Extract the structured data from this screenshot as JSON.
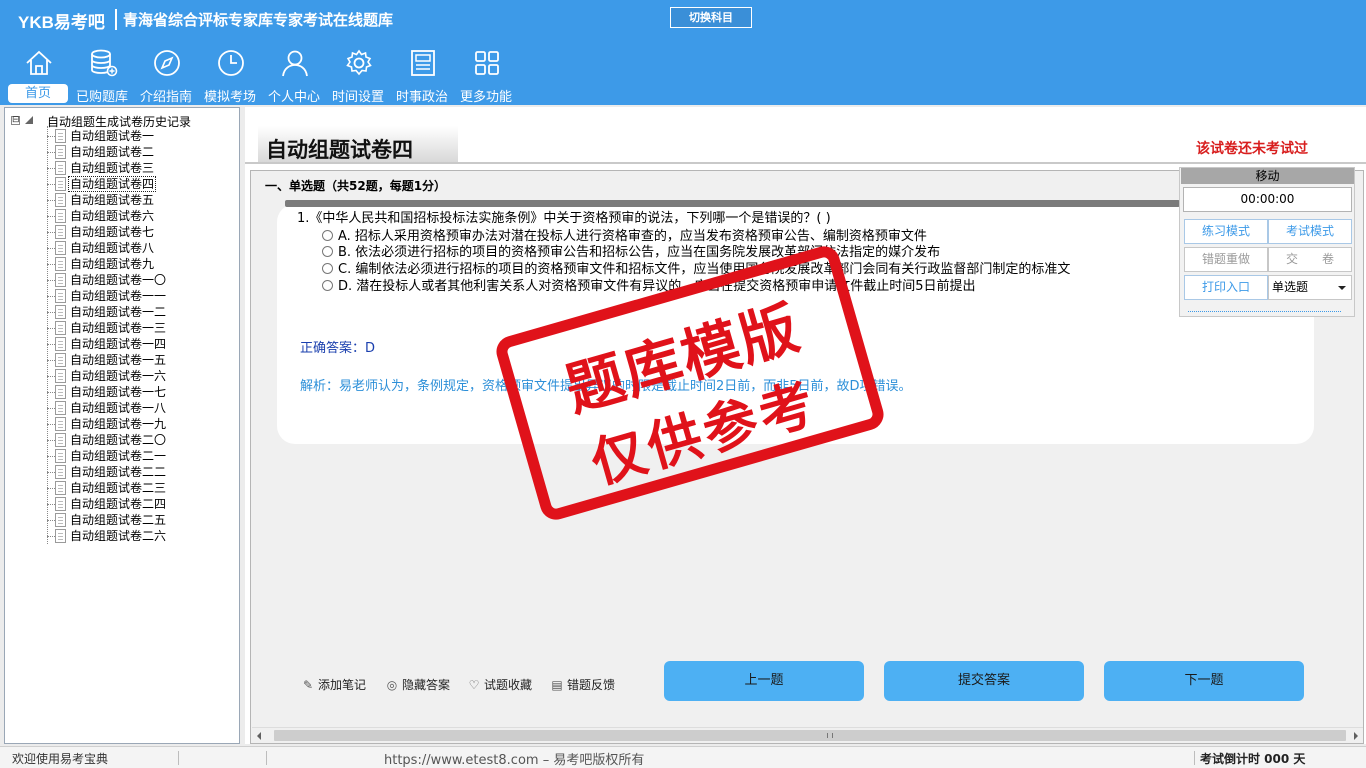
{
  "header": {
    "logo": "YKB易考吧",
    "title": "青海省综合评标专家库专家考试在线题库",
    "switch_subject": "切换科目"
  },
  "nav": [
    {
      "label": "首页",
      "icon": "home-icon"
    },
    {
      "label": "已购题库",
      "icon": "database-icon"
    },
    {
      "label": "介绍指南",
      "icon": "compass-icon"
    },
    {
      "label": "模拟考场",
      "icon": "clock-icon"
    },
    {
      "label": "个人中心",
      "icon": "user-icon"
    },
    {
      "label": "时间设置",
      "icon": "gear-icon"
    },
    {
      "label": "时事政治",
      "icon": "newspaper-icon"
    },
    {
      "label": "更多功能",
      "icon": "grid-icon"
    }
  ],
  "tree": {
    "toggle": "⊟",
    "root": "自动组题生成试卷历史记录",
    "items": [
      "自动组题试卷一",
      "自动组题试卷二",
      "自动组题试卷三",
      "自动组题试卷四",
      "自动组题试卷五",
      "自动组题试卷六",
      "自动组题试卷七",
      "自动组题试卷八",
      "自动组题试卷九",
      "自动组题试卷一〇",
      "自动组题试卷一一",
      "自动组题试卷一二",
      "自动组题试卷一三",
      "自动组题试卷一四",
      "自动组题试卷一五",
      "自动组题试卷一六",
      "自动组题试卷一七",
      "自动组题试卷一八",
      "自动组题试卷一九",
      "自动组题试卷二〇",
      "自动组题试卷二一",
      "自动组题试卷二二",
      "自动组题试卷二三",
      "自动组题试卷二四",
      "自动组题试卷二五",
      "自动组题试卷二六"
    ],
    "selected_index": 3
  },
  "paper": {
    "title": "自动组题试卷四",
    "status": "该试卷还未考试过",
    "section": "一、单选题（共52题，每题1分）"
  },
  "question": {
    "text": "1.《中华人民共和国招标投标法实施条例》中关于资格预审的说法，下列哪一个是错误的？( )",
    "options": [
      "A. 招标人采用资格预审办法对潜在投标人进行资格审查的，应当发布资格预审公告、编制资格预审文件",
      "B. 依法必须进行招标的项目的资格预审公告和招标公告，应当在国务院发展改革部门依法指定的媒介发布",
      "C. 编制依法必须进行招标的项目的资格预审文件和招标文件，应当使用国务院发展改革部门会同有关行政监督部门制定的标准文",
      "D. 潜在投标人或者其他利害关系人对资格预审文件有异议的，应当在提交资格预审申请文件截止时间5日前提出"
    ],
    "answer": "正确答案：D",
    "analysis": "解析：易老师认为，条例规定，资格预审文件提出异议的时限是截止时间2日前，而非5日前，故D项错误。"
  },
  "stamp": {
    "line1": "题库模版",
    "line2": "仅供参考"
  },
  "control": {
    "move": "移动",
    "timer": "00:00:00",
    "practice_mode": "练习模式",
    "exam_mode": "考试模式",
    "redo_wrong": "错题重做",
    "submit_paper": "交　　卷",
    "print": "打印入口",
    "type_select": "单选题"
  },
  "tools": {
    "add_note": "添加笔记",
    "hide_answer": "隐藏答案",
    "favorite": "试题收藏",
    "feedback": "错题反馈"
  },
  "buttons": {
    "prev": "上一题",
    "submit": "提交答案",
    "next": "下一题"
  },
  "status": {
    "welcome": "欢迎使用易考宝典",
    "url": "https://www.etest8.com – 易考吧版权所有",
    "countdown": "考试倒计时 000 天"
  }
}
